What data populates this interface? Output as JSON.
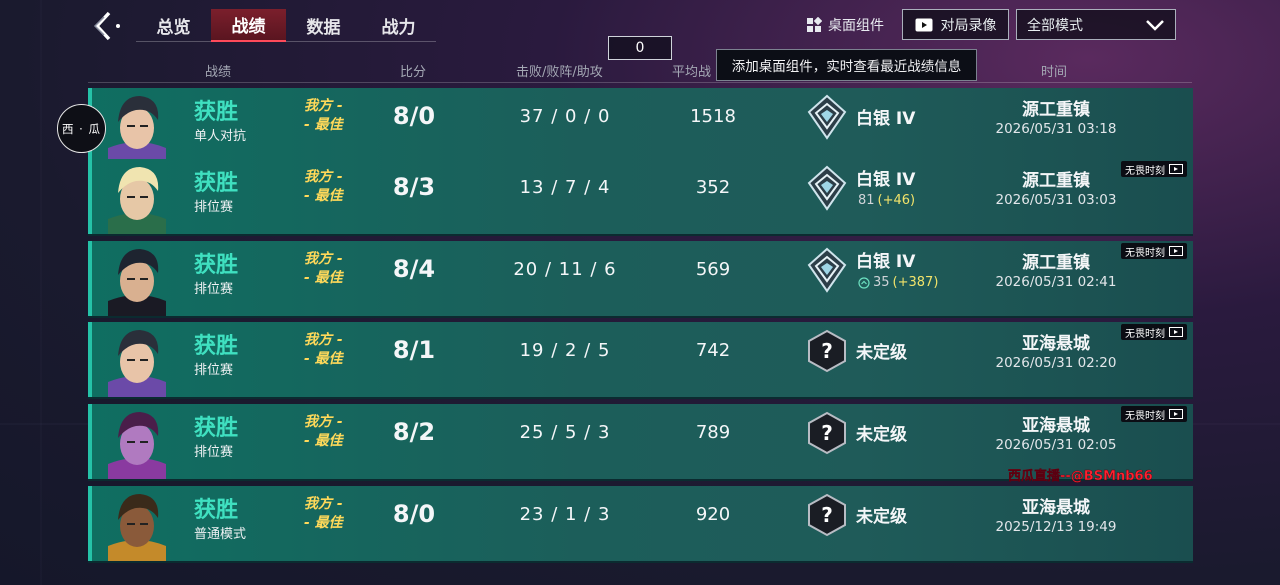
{
  "tabs": [
    "总览",
    "战绩",
    "数据",
    "战力"
  ],
  "active_tab": 1,
  "counter": "0",
  "widget_button": "桌面组件",
  "replay_button": "对局录像",
  "mode_select": "全部模式",
  "tooltip": "添加桌面组件，实时查看最近战绩信息",
  "headers": {
    "record": "战绩",
    "score": "比分",
    "kda": "击败/败阵/助攻",
    "avg": "平均战",
    "time": "时间"
  },
  "user_badge": "西 · 瓜",
  "rows": [
    {
      "result": "获胜",
      "mode": "单人对抗",
      "mvp1": "我方 -",
      "mvp2": "- 最佳",
      "score": "8/0",
      "kda": "37 / 0 / 0",
      "avg": "1518",
      "rank": "白银 IV",
      "rank_pts": "",
      "rank_gain": "",
      "map": "源工重镇",
      "date": "2026/05/31 03:18",
      "tag": ""
    },
    {
      "result": "获胜",
      "mode": "排位赛",
      "mvp1": "我方 -",
      "mvp2": "- 最佳",
      "score": "8/3",
      "kda": "13 / 7 / 4",
      "avg": "352",
      "rank": "白银 IV",
      "rank_pts": "81",
      "rank_gain": "(+46)",
      "map": "源工重镇",
      "date": "2026/05/31 03:03",
      "tag": "无畏时刻"
    },
    {
      "result": "获胜",
      "mode": "排位赛",
      "mvp1": "我方 -",
      "mvp2": "- 最佳",
      "score": "8/4",
      "kda": "20 / 11 / 6",
      "avg": "569",
      "rank": "白银 IV",
      "rank_pts": "35",
      "rank_gain": "(+387)",
      "map": "源工重镇",
      "date": "2026/05/31 02:41",
      "tag": "无畏时刻"
    },
    {
      "result": "获胜",
      "mode": "排位赛",
      "mvp1": "我方 -",
      "mvp2": "- 最佳",
      "score": "8/1",
      "kda": "19 / 2 / 5",
      "avg": "742",
      "rank": "未定级",
      "rank_pts": "",
      "rank_gain": "",
      "map": "亚海悬城",
      "date": "2026/05/31 02:20",
      "tag": "无畏时刻"
    },
    {
      "result": "获胜",
      "mode": "排位赛",
      "mvp1": "我方 -",
      "mvp2": "- 最佳",
      "score": "8/2",
      "kda": "25 / 5 / 3",
      "avg": "789",
      "rank": "未定级",
      "rank_pts": "",
      "rank_gain": "",
      "map": "亚海悬城",
      "date": "2026/05/31 02:05",
      "tag": "无畏时刻"
    },
    {
      "result": "获胜",
      "mode": "普通模式",
      "mvp1": "我方 -",
      "mvp2": "- 最佳",
      "score": "8/0",
      "kda": "23 / 1 / 3",
      "avg": "920",
      "rank": "未定级",
      "rank_pts": "",
      "rank_gain": "",
      "map": "亚海悬城",
      "date": "2025/12/13 19:49",
      "tag": ""
    }
  ],
  "watermark": "西瓜直播--@BSMnb66",
  "colors": {
    "win": "#3fe0c0",
    "mvp": "#ffd95a",
    "active_tab": "#7b1f2c",
    "row_bg": "#1c5e5a",
    "gain": "#f2e36a",
    "watermark": "#ff2230"
  }
}
